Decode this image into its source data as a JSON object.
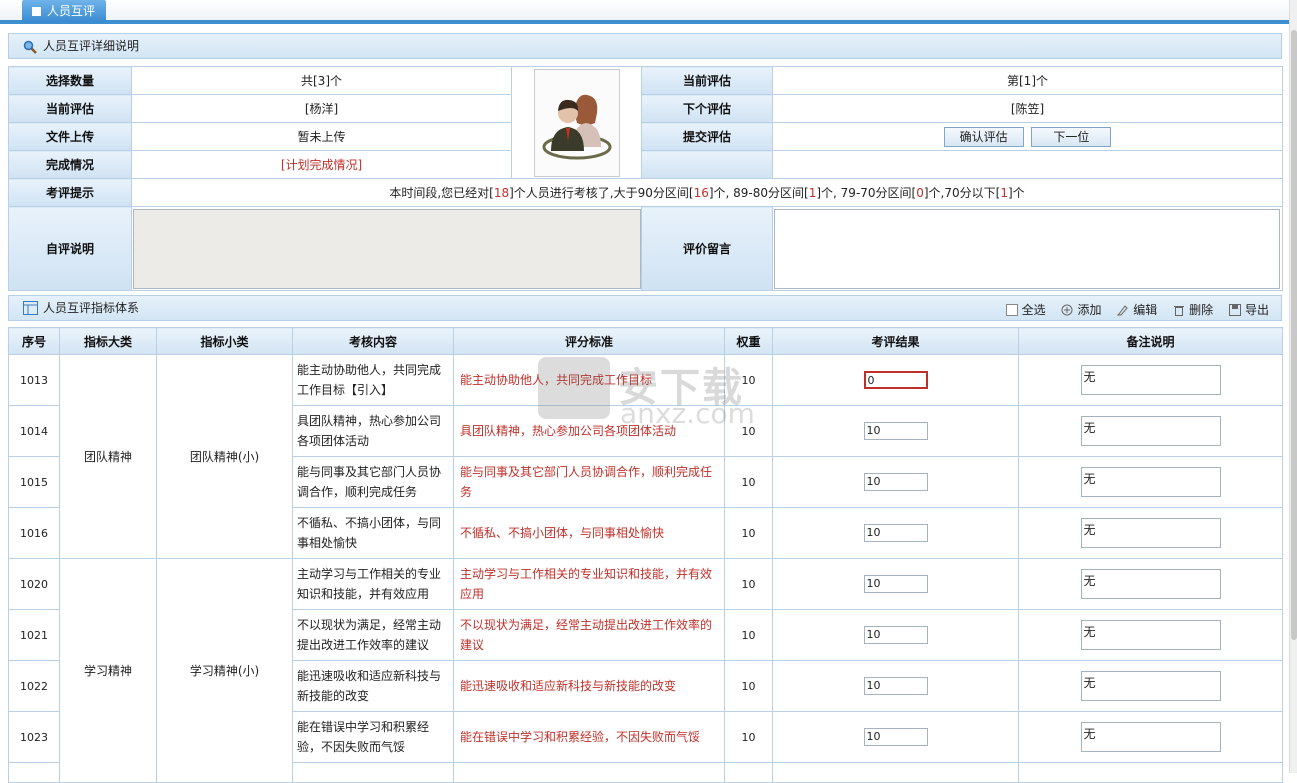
{
  "tab": {
    "label": "人员互评"
  },
  "section1": {
    "title": "人员互评详细说明"
  },
  "info": {
    "select_count_label": "选择数量",
    "select_count_value": "共[3]个",
    "current_eval_label": "当前评估",
    "current_eval_value": "[杨洋]",
    "file_upload_label": "文件上传",
    "file_upload_value": "暂未上传",
    "completion_label": "完成情况",
    "completion_value": "[计划完成情况]",
    "right_current_label": "当前评估",
    "right_current_value": "第[1]个",
    "next_label": "下个评估",
    "next_value": "[陈笠]",
    "submit_label": "提交评估",
    "confirm_button": "确认评估",
    "next_button": "下一位",
    "tip_label": "考评提示",
    "tip_parts": [
      "本时间段,您已经对[",
      "18",
      "]个人员进行考核了,大于90分区间[",
      "16",
      "]个, 89-80分区间[",
      "1",
      "]个, 79-70分区间[",
      "0",
      "]个,70分以下[",
      "1",
      "]个"
    ],
    "self_label": "自评说明",
    "comment_label": "评价留言"
  },
  "section2": {
    "title": "人员互评指标体系"
  },
  "toolbar": {
    "select_all": "全选",
    "add": "添加",
    "edit": "编辑",
    "delete": "删除",
    "export": "导出"
  },
  "grid": {
    "headers": [
      "序号",
      "指标大类",
      "指标小类",
      "考核内容",
      "评分标准",
      "权重",
      "考评结果",
      "备注说明"
    ],
    "groups": [
      {
        "major": "团队精神",
        "minor": "团队精神(小)"
      },
      {
        "major": "学习精神",
        "minor": "学习精神(小)"
      }
    ],
    "rows": [
      {
        "id": "1013",
        "content": "能主动协助他人，共同完成工作目标【引入】",
        "standard": "能主动协助他人，共同完成工作目标",
        "weight": "10",
        "result": "0",
        "note": "无"
      },
      {
        "id": "1014",
        "content": "具团队精神，热心参加公司各项团体活动",
        "standard": "具团队精神，热心参加公司各项团体活动",
        "weight": "10",
        "result": "10",
        "note": "无"
      },
      {
        "id": "1015",
        "content": "能与同事及其它部门人员协调合作，顺利完成任务",
        "standard": "能与同事及其它部门人员协调合作，顺利完成任务",
        "weight": "10",
        "result": "10",
        "note": "无"
      },
      {
        "id": "1016",
        "content": "不循私、不搞小团体，与同事相处愉快",
        "standard": "不循私、不搞小团体，与同事相处愉快",
        "weight": "10",
        "result": "10",
        "note": "无"
      },
      {
        "id": "1020",
        "content": "主动学习与工作相关的专业知识和技能，并有效应用",
        "standard": "主动学习与工作相关的专业知识和技能，并有效应用",
        "weight": "10",
        "result": "10",
        "note": "无"
      },
      {
        "id": "1021",
        "content": "不以现状为满足，经常主动提出改进工作效率的建议",
        "standard": "不以现状为满足，经常主动提出改进工作效率的建议",
        "weight": "10",
        "result": "10",
        "note": "无"
      },
      {
        "id": "1022",
        "content": "能迅速吸收和适应新科技与新技能的改变",
        "standard": "能迅速吸收和适应新科技与新技能的改变",
        "weight": "10",
        "result": "10",
        "note": "无"
      },
      {
        "id": "1023",
        "content": "能在错误中学习和积累经验，不因失败而气馁",
        "standard": "能在错误中学习和积累经验，不因失败而气馁",
        "weight": "10",
        "result": "10",
        "note": "无"
      }
    ]
  },
  "watermark": {
    "zh": "安下载",
    "en": "anxz.com"
  }
}
